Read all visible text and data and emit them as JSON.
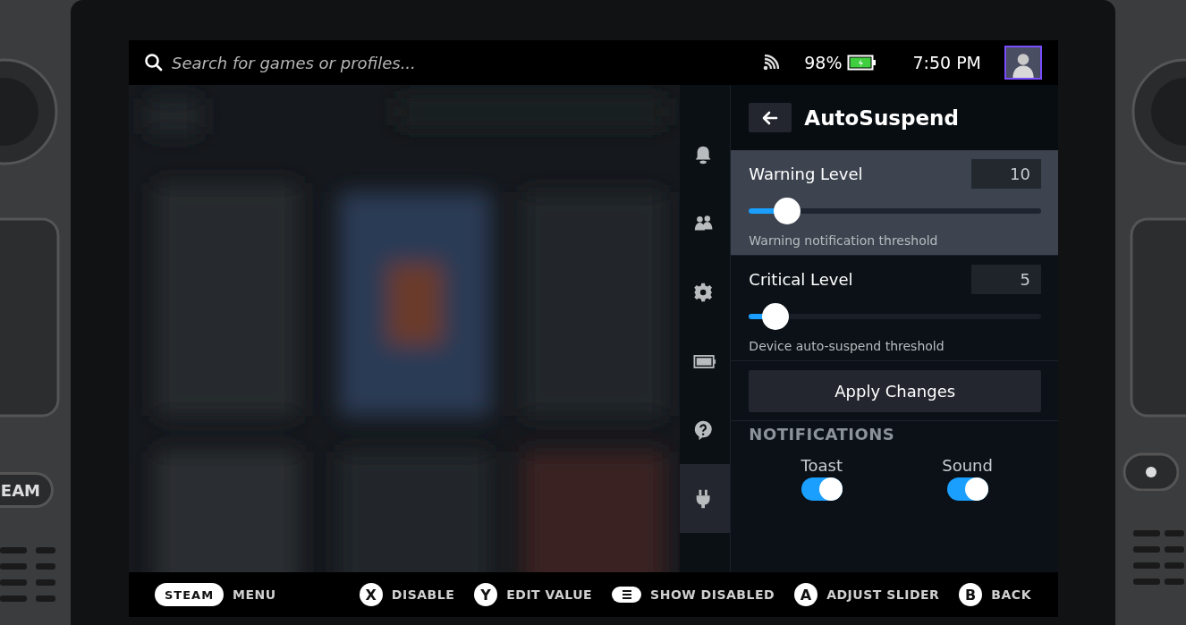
{
  "device": {
    "left_button_label": "EAM"
  },
  "top_bar": {
    "search": {
      "placeholder": "Search for games or profiles..."
    },
    "battery": {
      "reading": "98%",
      "level": 0.98
    },
    "time": "7:50 PM"
  },
  "quick_access": {
    "tabs": [
      {
        "kind": "bell",
        "selected": false
      },
      {
        "kind": "friends",
        "selected": false
      },
      {
        "kind": "gear",
        "selected": false
      },
      {
        "kind": "battery",
        "selected": false
      },
      {
        "kind": "help",
        "selected": false
      },
      {
        "kind": "plug",
        "selected": true
      }
    ]
  },
  "panel": {
    "title": "AutoSuspend",
    "sliders": [
      {
        "label": "Warning Level",
        "value": "10",
        "level": 0.13,
        "description": "Warning notification threshold",
        "focused": true
      },
      {
        "label": "Critical Level",
        "value": "5",
        "level": 0.09,
        "description": "Device auto-suspend threshold",
        "focused": false
      }
    ],
    "apply_button": "Apply Changes",
    "section_title": "NOTIFICATIONS",
    "toggles": [
      {
        "label": "Toast",
        "on": true
      },
      {
        "label": "Sound",
        "on": true
      }
    ]
  },
  "footer": {
    "hints": [
      {
        "kind": "pill",
        "glyph": "STEAM",
        "label": "MENU"
      },
      {
        "kind": "circle",
        "glyph": "X",
        "label": "DISABLE"
      },
      {
        "kind": "circle",
        "glyph": "Y",
        "label": "EDIT VALUE"
      },
      {
        "kind": "menu",
        "label": "SHOW DISABLED"
      },
      {
        "kind": "circle",
        "glyph": "A",
        "label": "ADJUST SLIDER"
      },
      {
        "kind": "circle",
        "glyph": "B",
        "label": "BACK"
      }
    ]
  }
}
